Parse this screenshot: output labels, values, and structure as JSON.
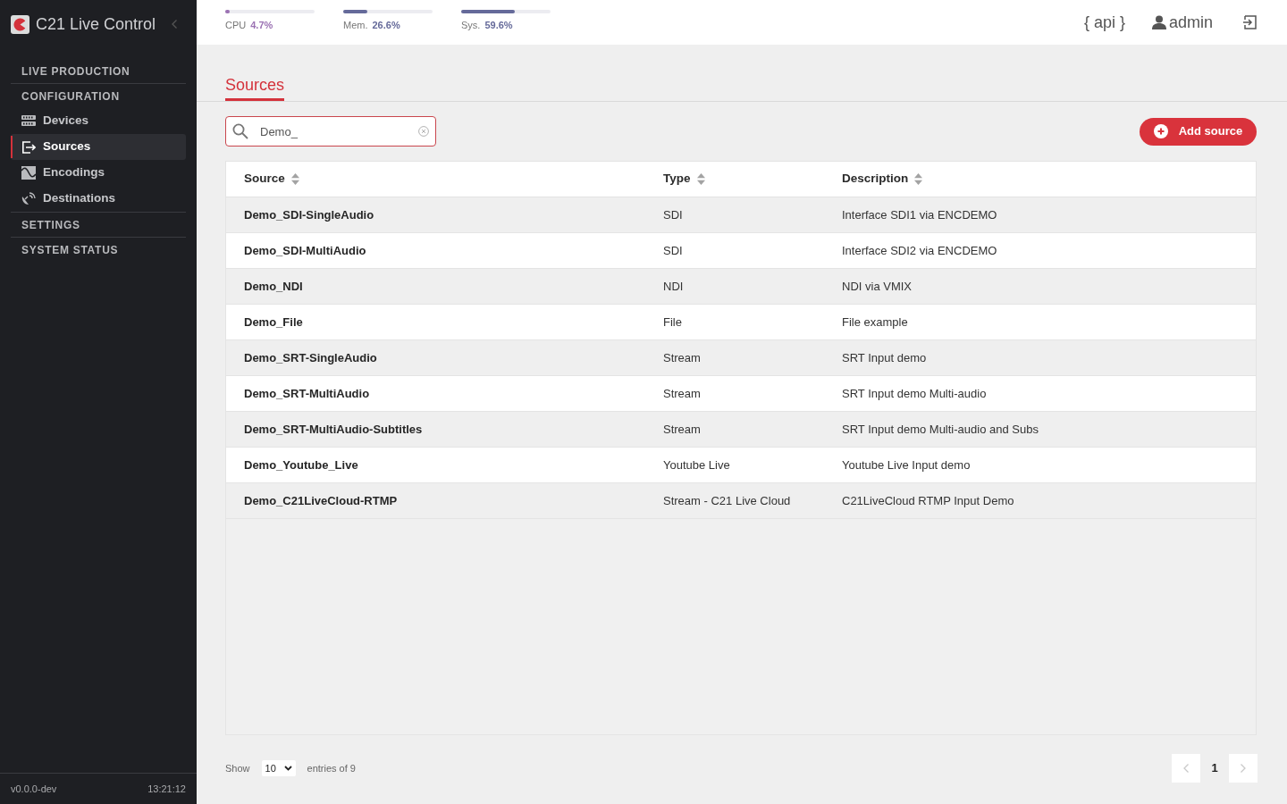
{
  "sidebar": {
    "brand": "C21 Live Control",
    "sections": [
      {
        "title": "LIVE PRODUCTION"
      },
      {
        "title": "CONFIGURATION",
        "items": [
          {
            "label": "Devices",
            "kind": "rack",
            "selected": false
          },
          {
            "label": "Sources",
            "kind": "export",
            "selected": true
          },
          {
            "label": "Encodings",
            "kind": "wave",
            "selected": false
          },
          {
            "label": "Destinations",
            "kind": "dish",
            "selected": false
          }
        ]
      },
      {
        "title": "SETTINGS"
      },
      {
        "title": "SYSTEM STATUS"
      }
    ],
    "version": "v0.0.0-dev",
    "time": "13:21:12"
  },
  "header": {
    "meters": [
      {
        "label": "CPU",
        "reading": "4.7%",
        "level": 0.047,
        "color": "#9b72b3"
      },
      {
        "label": "Mem.",
        "reading": "26.6%",
        "level": 0.266,
        "color": "#656a9a"
      },
      {
        "label": "Sys.",
        "reading": "59.6%",
        "level": 0.596,
        "color": "#656a9a"
      }
    ],
    "api_link": "{ api }",
    "user": "admin"
  },
  "content": {
    "tabs": [
      {
        "label": "Sources",
        "selected": true
      }
    ],
    "search": {
      "value": "Demo_"
    },
    "add_button": "Add source",
    "table": {
      "columns": [
        "Source",
        "Type",
        "Description"
      ],
      "rows": [
        [
          "Demo_SDI-SingleAudio",
          "SDI",
          "Interface SDI1 via ENCDEMO"
        ],
        [
          "Demo_SDI-MultiAudio",
          "SDI",
          "Interface SDI2 via ENCDEMO"
        ],
        [
          "Demo_NDI",
          "NDI",
          "NDI via VMIX"
        ],
        [
          "Demo_File",
          "File",
          "File example"
        ],
        [
          "Demo_SRT-SingleAudio",
          "Stream",
          "SRT Input demo"
        ],
        [
          "Demo_SRT-MultiAudio",
          "Stream",
          "SRT Input demo Multi-audio"
        ],
        [
          "Demo_SRT-MultiAudio-Subtitles",
          "Stream",
          "SRT Input demo Multi-audio and Subs"
        ],
        [
          "Demo_Youtube_Live",
          "Youtube Live",
          "Youtube Live Input demo"
        ],
        [
          "Demo_C21LiveCloud-RTMP",
          "Stream - C21 Live Cloud",
          "C21LiveCloud RTMP Input Demo"
        ]
      ]
    },
    "pagination": {
      "show_label": "Show",
      "page_size": "10",
      "entries_label": "entries of 9",
      "previous": {
        "disabled": true
      },
      "pages": [
        {
          "label": "1",
          "selected": true
        }
      ],
      "next": {
        "disabled": true
      }
    }
  }
}
